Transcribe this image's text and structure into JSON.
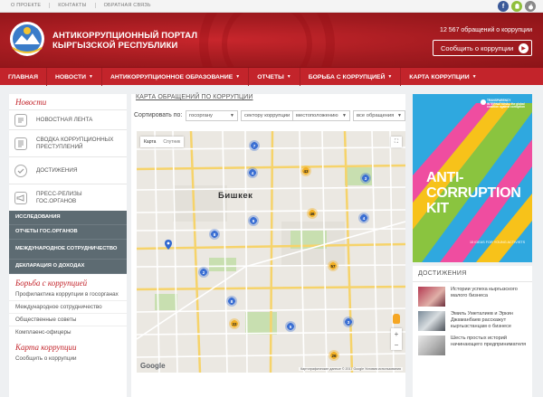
{
  "topbar": {
    "links": [
      "О ПРОЕКТЕ",
      "КОНТАКТЫ",
      "ОБРАТНАЯ СВЯЗЬ"
    ],
    "social_icons": [
      "facebook-icon",
      "android-icon",
      "apple-icon"
    ]
  },
  "header": {
    "title_line1": "АНТИКОРРУПЦИОННЫЙ ПОРТАЛ",
    "title_line2": "КЫРГЫЗСКОЙ РЕСПУБЛИКИ",
    "stats": "12 567 обращений о коррупции",
    "report_button": "Сообщить о коррупции",
    "accent": "#c3242b"
  },
  "nav": {
    "items": [
      {
        "label": "ГЛАВНАЯ",
        "dropdown": false
      },
      {
        "label": "НОВОСТИ",
        "dropdown": true
      },
      {
        "label": "АНТИКОРРУПЦИОННОЕ ОБРАЗОВАНИЕ",
        "dropdown": true
      },
      {
        "label": "ОТЧЕТЫ",
        "dropdown": true
      },
      {
        "label": "БОРЬБА С КОРРУПЦИЕЙ",
        "dropdown": true
      },
      {
        "label": "КАРТА КОРРУПЦИИ",
        "dropdown": true
      }
    ]
  },
  "sidebar": {
    "news_title": "Новости",
    "news_items": [
      "НОВОСТНАЯ ЛЕНТА",
      "СВОДКА КОРРУПЦИОННЫХ ПРЕСТУПЛЕНИЙ",
      "ДОСТИЖЕНИЯ",
      "ПРЕСС-РЕЛИЗЫ ГОС.ОРГАНОВ"
    ],
    "dark_items": [
      "ИССЛЕДОВАНИЯ",
      "ОТЧЕТЫ ГОС.ОРГАНОВ",
      "МЕЖДУНАРОДНОЕ СОТРУДНИЧЕСТВО",
      "ДЕКЛАРАЦИЯ О ДОХОДАХ"
    ],
    "fight_title": "Борьба с коррупцией",
    "fight_items": [
      "Профилактика коррупции в госорганах",
      "Международное сотрудничество",
      "Общественные советы",
      "Комплаенс-офицеры"
    ],
    "map_title": "Карта коррупции",
    "map_items": [
      "Сообщить о коррупции"
    ]
  },
  "main": {
    "title": "КАРТА ОБРАЩЕНИЙ ПО КОРРУПЦИИ",
    "sort_label": "Сортировать по:",
    "filters": [
      "госоргану",
      "сектору коррупции",
      "местоположению",
      "все обращения"
    ],
    "map": {
      "tab_map": "Карта",
      "tab_sat": "Спутник",
      "city": "Бишкек",
      "google": "Google",
      "copyright": "Картографические данные © 2017 Google    Условия использования",
      "clusters": [
        {
          "label": "7",
          "color": "blue"
        },
        {
          "label": "43",
          "color": "yellow"
        },
        {
          "label": "3",
          "color": "blue"
        },
        {
          "label": "4",
          "color": "blue"
        },
        {
          "label": "9",
          "color": "blue"
        },
        {
          "label": "46",
          "color": "yellow"
        },
        {
          "label": "4",
          "color": "blue"
        },
        {
          "label": "8",
          "color": "blue"
        },
        {
          "label": "2",
          "color": "blue"
        },
        {
          "label": "57",
          "color": "yellow"
        },
        {
          "label": "8",
          "color": "blue"
        },
        {
          "label": "22",
          "color": "yellow"
        },
        {
          "label": "5",
          "color": "blue"
        },
        {
          "label": "3",
          "color": "blue"
        },
        {
          "label": "26",
          "color": "yellow"
        }
      ]
    }
  },
  "banner": {
    "org": "TRANSPARENCY INTERNATIONAL the global coalition against corruption",
    "line1": "ANTI-",
    "line2": "CORRUPTION",
    "line3": "KIT",
    "small": "15 IDEAS FOR YOUNG ACTIVISTS"
  },
  "achievements": {
    "title": "ДОСТИЖЕНИЯ",
    "items": [
      "Истории успеха кыргызского малого бизнеса",
      "Эмиль Уметалиев и Эркин Джаманбаев расскажут кыргызстанцам о бизнесе",
      "Шесть простых историй начинающего предпринимателя"
    ]
  }
}
